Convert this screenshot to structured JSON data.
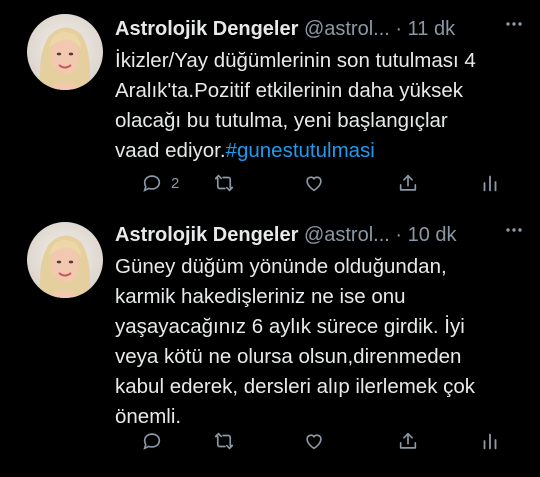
{
  "tweets": [
    {
      "name": "Astrolojik Dengeler",
      "handle": "@astrol...",
      "time": "· 11 dk",
      "lines": [
        "İkizler/Yay düğümlerinin son tutulması 4",
        "Aralık'ta.Pozitif etkilerinin daha yüksek",
        "olacağı bu tutulma, yeni başlangıçlar"
      ],
      "last_line_text": "vaad ediyor.",
      "hashtag": "#gunestutulmasi",
      "reply_count": "2"
    },
    {
      "name": "Astrolojik Dengeler",
      "handle": "@astrol...",
      "time": "· 10 dk",
      "lines": [
        "Güney düğüm yönünde olduğundan,",
        "karmik hakedişleriniz ne ise onu",
        "yaşayacağınız 6 aylık sürece girdik. İyi",
        "veya kötü ne olursa olsun,direnmeden",
        "kabul ederek, dersleri alıp ilerlemek çok",
        "önemli."
      ],
      "reply_count": ""
    }
  ],
  "icons": {
    "reply": "reply-icon",
    "retweet": "retweet-icon",
    "like": "heart-icon",
    "share": "share-icon",
    "analytics": "analytics-icon",
    "more": "more-icon"
  },
  "colors": {
    "background": "#000000",
    "text": "#e7e9ea",
    "muted": "#8b98a5",
    "link": "#1d9bf0"
  }
}
